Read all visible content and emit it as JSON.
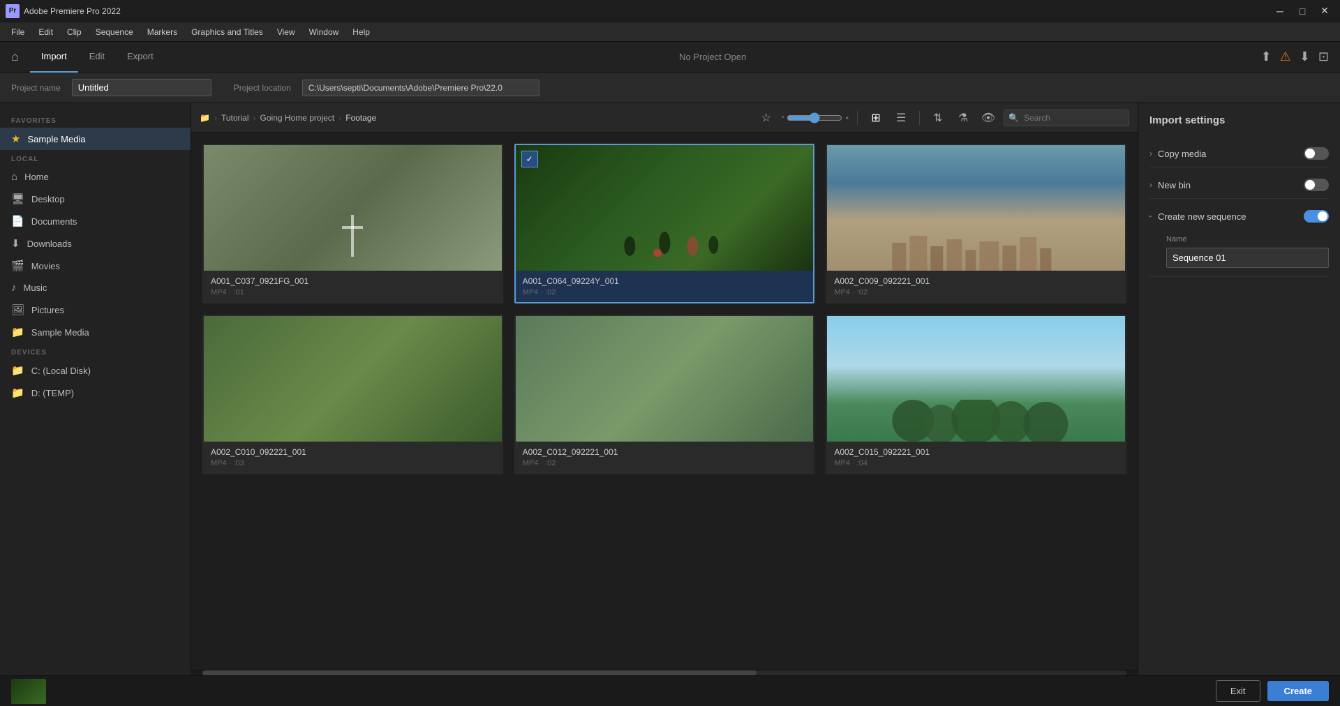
{
  "titlebar": {
    "app_name": "Adobe Premiere Pro 2022",
    "app_icon": "Pr",
    "min_btn": "─",
    "max_btn": "□",
    "close_btn": "✕"
  },
  "menubar": {
    "items": [
      "File",
      "Edit",
      "Clip",
      "Sequence",
      "Markers",
      "Graphics and Titles",
      "View",
      "Window",
      "Help"
    ]
  },
  "topnav": {
    "center_title": "No Project Open",
    "tabs": [
      "Import",
      "Edit",
      "Export"
    ]
  },
  "projectbar": {
    "project_name_label": "Project name",
    "project_name_value": "Untitled",
    "project_location_label": "Project location",
    "project_location_value": "C:\\Users\\septi\\Documents\\Adobe\\Premiere Pro\\22.0"
  },
  "sidebar": {
    "favorites_label": "FAVORITES",
    "favorites_items": [
      {
        "label": "Sample Media",
        "icon": "★"
      }
    ],
    "local_label": "LOCAL",
    "local_items": [
      {
        "label": "Home",
        "icon": "⌂"
      },
      {
        "label": "Desktop",
        "icon": "🖥"
      },
      {
        "label": "Documents",
        "icon": "📄"
      },
      {
        "label": "Downloads",
        "icon": "⬇"
      },
      {
        "label": "Movies",
        "icon": "🎬"
      },
      {
        "label": "Music",
        "icon": "♪"
      },
      {
        "label": "Pictures",
        "icon": "🖼"
      },
      {
        "label": "Sample Media",
        "icon": "📁"
      }
    ],
    "devices_label": "DEVICES",
    "devices_items": [
      {
        "label": "C: (Local Disk)",
        "icon": "💾"
      },
      {
        "label": "D: (TEMP)",
        "icon": "💾"
      }
    ]
  },
  "browser": {
    "breadcrumb": {
      "root_icon": "📁",
      "items": [
        "Tutorial",
        "Going Home project",
        "Footage"
      ]
    },
    "search_placeholder": "Search",
    "view_grid_label": "Grid view",
    "view_list_label": "List view",
    "sort_label": "Sort",
    "filter_label": "Filter",
    "preview_label": "Preview"
  },
  "media_items": [
    {
      "name": "A001_C037_0921FG_001",
      "meta": "MP4 · :01",
      "selected": false,
      "thumb_class": "thumb-scene1",
      "id": "media1"
    },
    {
      "name": "A001_C064_09224Y_001",
      "meta": "MP4 · :02",
      "selected": true,
      "thumb_class": "thumb-scene2",
      "id": "media2"
    },
    {
      "name": "A002_C009_092221_001",
      "meta": "MP4 · :02",
      "selected": false,
      "thumb_class": "thumb-scene3",
      "id": "media3"
    },
    {
      "name": "A002_C010_092221_001",
      "meta": "MP4 · :03",
      "selected": false,
      "thumb_class": "thumb-scene4",
      "id": "media4"
    },
    {
      "name": "A002_C012_092221_001",
      "meta": "MP4 · :02",
      "selected": false,
      "thumb_class": "thumb-scene5",
      "id": "media5"
    },
    {
      "name": "A002_C015_092221_001",
      "meta": "MP4 · :04",
      "selected": false,
      "thumb_class": "thumb-scene6",
      "id": "media6"
    }
  ],
  "import_settings": {
    "title": "Import settings",
    "copy_media_label": "Copy media",
    "copy_media_on": false,
    "new_bin_label": "New bin",
    "new_bin_on": false,
    "create_sequence_label": "Create new sequence",
    "create_sequence_on": true,
    "sequence_name_label": "Name",
    "sequence_name_value": "Sequence 01"
  },
  "bottom": {
    "exit_label": "Exit",
    "create_label": "Create"
  }
}
